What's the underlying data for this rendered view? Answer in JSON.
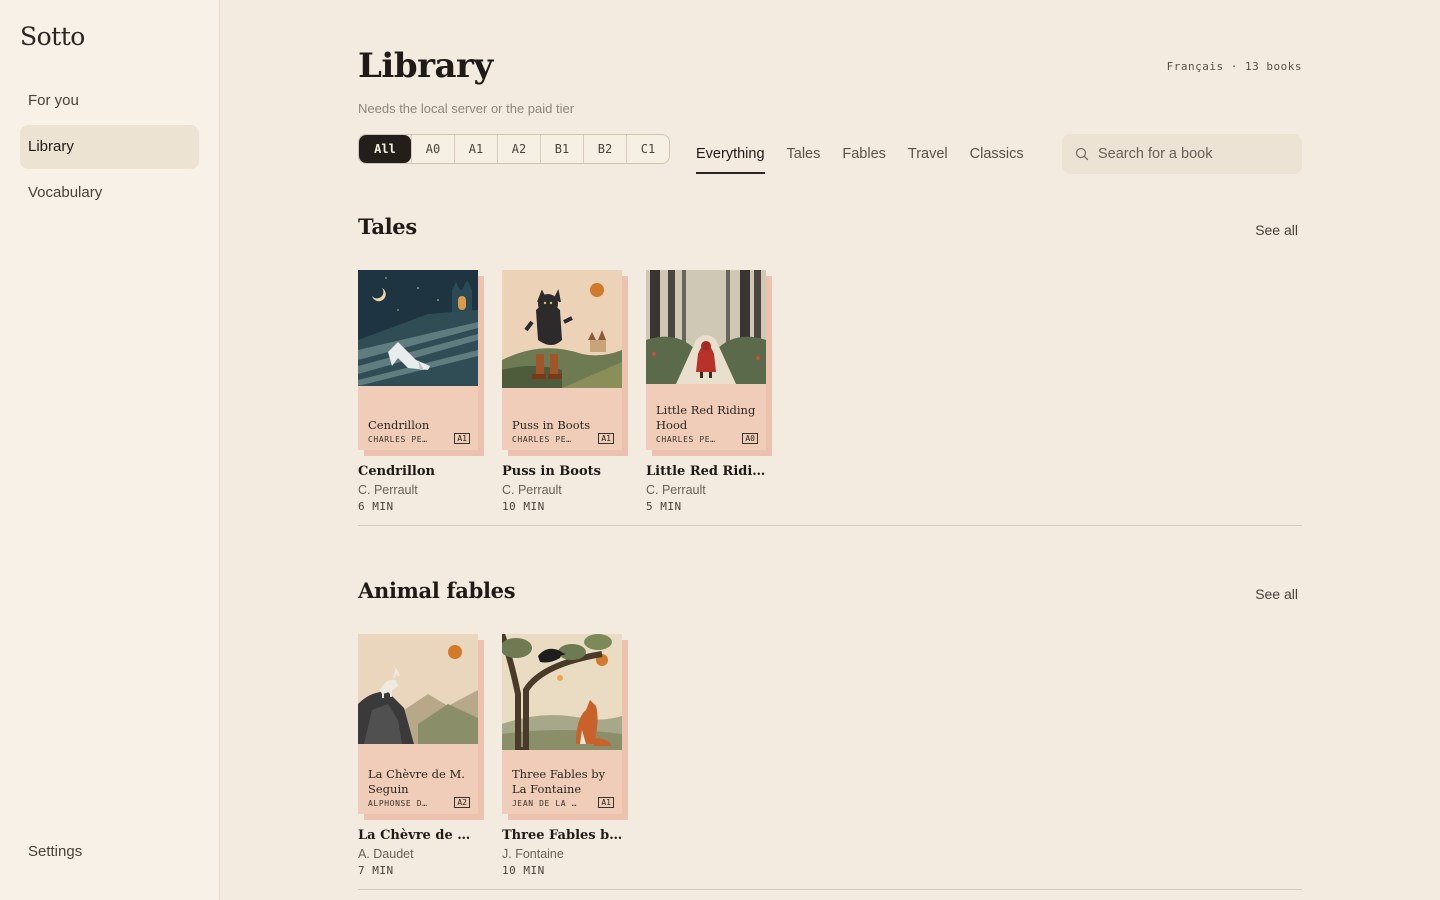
{
  "app": {
    "name": "Sotto"
  },
  "sidebar": {
    "items": [
      {
        "label": "For you"
      },
      {
        "label": "Library"
      },
      {
        "label": "Vocabulary"
      }
    ],
    "settings_label": "Settings"
  },
  "header": {
    "title": "Library",
    "meta": "Français · 13 books",
    "subtitle": "Needs the local server or the paid tier"
  },
  "filters": {
    "levels": [
      "All",
      "A0",
      "A1",
      "A2",
      "B1",
      "B2",
      "C1"
    ],
    "selected_level": "All",
    "tabs": [
      "Everything",
      "Tales",
      "Fables",
      "Travel",
      "Classics"
    ],
    "selected_tab": "Everything"
  },
  "search": {
    "placeholder": "Search for a book"
  },
  "sections": [
    {
      "title": "Tales",
      "see_all": "See all",
      "books": [
        {
          "cover_title": "Cendrillon",
          "cover_author": "CHARLES PE…",
          "level": "A1",
          "title": "Cendrillon",
          "author": "C. Perrault",
          "time": "6 MIN"
        },
        {
          "cover_title": "Puss in Boots",
          "cover_author": "CHARLES PE…",
          "level": "A1",
          "title": "Puss in Boots",
          "author": "C. Perrault",
          "time": "10 MIN"
        },
        {
          "cover_title": "Little Red Riding Hood",
          "cover_author": "CHARLES PE…",
          "level": "A0",
          "title": "Little Red Riding…",
          "author": "C. Perrault",
          "time": "5 MIN"
        }
      ]
    },
    {
      "title": "Animal fables",
      "see_all": "See all",
      "books": [
        {
          "cover_title": "La Chèvre de M. Seguin",
          "cover_author": "ALPHONSE D…",
          "level": "A2",
          "title": "La Chèvre de M. …",
          "author": "A. Daudet",
          "time": "7 MIN"
        },
        {
          "cover_title": "Three Fables by La Fontaine",
          "cover_author": "JEAN DE LA …",
          "level": "A1",
          "title": "Three Fables by …",
          "author": "J. Fontaine",
          "time": "10 MIN"
        }
      ]
    }
  ],
  "colors": {
    "background": "#f3ebdf",
    "sidebar": "#f7f1e7",
    "accent": "#231e1a",
    "cover": "#f0cdb8"
  }
}
